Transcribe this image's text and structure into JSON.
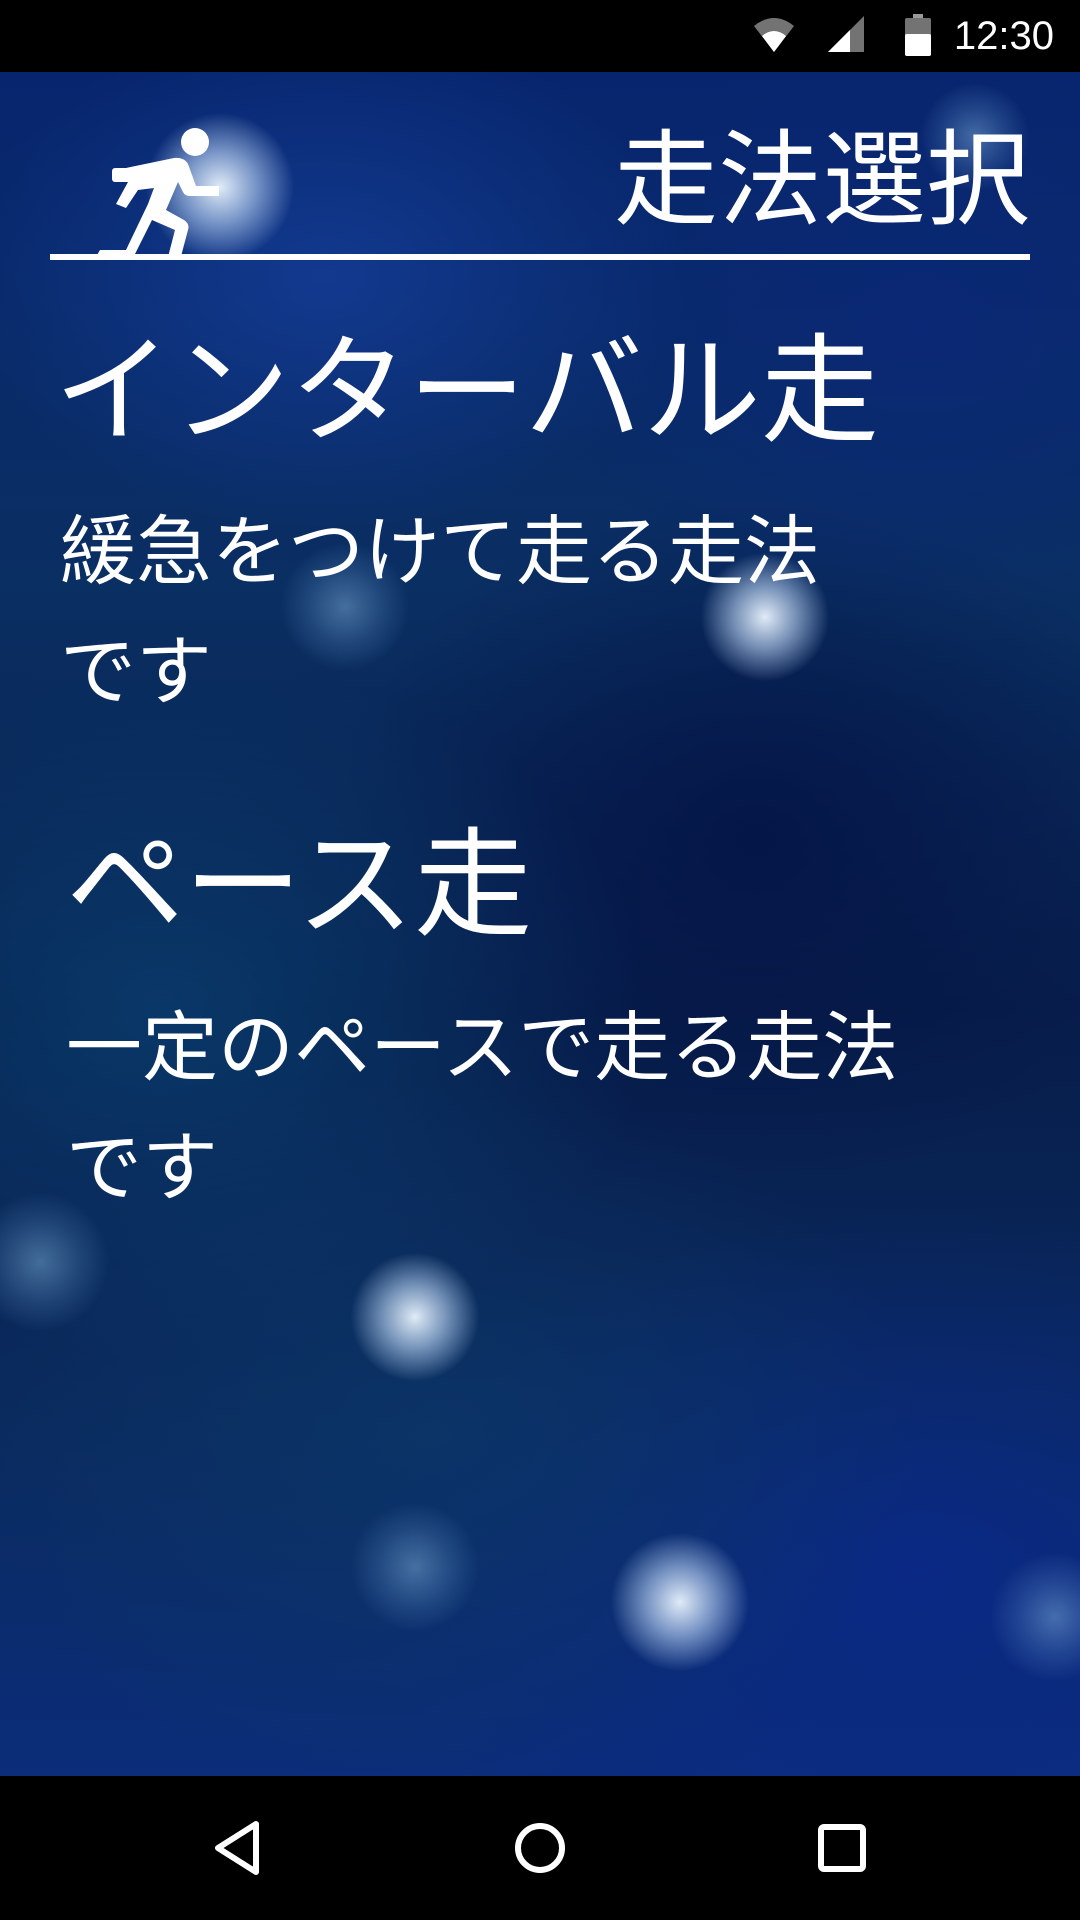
{
  "status_bar": {
    "time": "12:30",
    "icons": [
      "wifi-icon",
      "cell-signal-icon",
      "battery-icon"
    ]
  },
  "header": {
    "title": "走法選択",
    "icon": "runner-icon"
  },
  "options": [
    {
      "title": "インターバル走",
      "description": "緩急をつけて走る走法です"
    },
    {
      "title": "ペース走",
      "description": "一定のペースで走る走法です"
    }
  ],
  "nav_bar": {
    "icons": [
      "back-icon",
      "home-icon",
      "recents-icon"
    ]
  },
  "colors": {
    "text": "#ffffff",
    "bars": "#000000",
    "background_primary": "#0a2a5e"
  }
}
